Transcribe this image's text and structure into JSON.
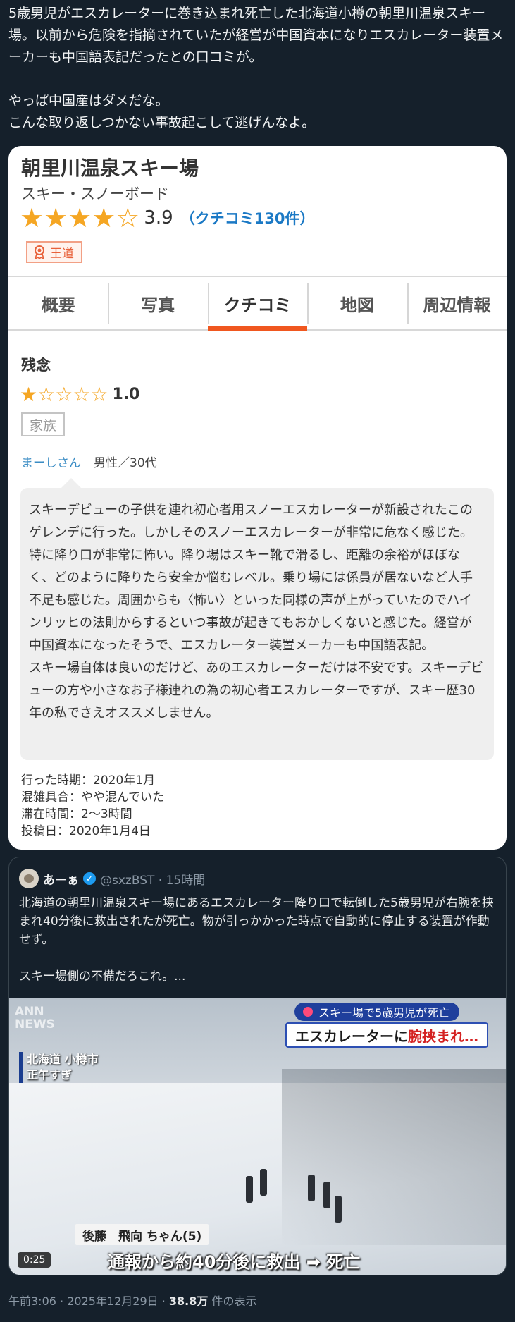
{
  "tweet": {
    "text": "5歳男児がエスカレーターに巻き込まれ死亡した北海道小樽の朝里川温泉スキー場。以前から危険を指摘されていたが経営が中国資本になりエスカレーター装置メーカーも中国語表記だったとの口コミが。\n\nやっぱ中国産はダメだな。\nこんな取り返しつかない事故起こして逃げんなよ。"
  },
  "review_card": {
    "place_title": "朝里川温泉スキー場",
    "category": "スキー・スノーボード",
    "stars_full": "★★★★",
    "stars_empty": "☆",
    "rating": "3.9",
    "review_count": "（クチコミ130件）",
    "badge": "王道",
    "tabs": [
      "概要",
      "写真",
      "クチコミ",
      "地図",
      "周辺情報"
    ],
    "active_tab": "クチコミ",
    "review": {
      "title": "残念",
      "stars_full": "★",
      "stars_empty": "☆☆☆☆",
      "rating": "1.0",
      "tag": "家族",
      "user_name": "まーしさん",
      "user_meta": "男性／30代",
      "body": "スキーデビューの子供を連れ初心者用スノーエスカレーターが新設されたこのゲレンデに行った。しかしそのスノーエスカレーターが非常に危なく感じた。特に降り口が非常に怖い。降り場はスキー靴で滑るし、距離の余裕がほぼなく、どのように降りたら安全か悩むレベル。乗り場には係員が居ないなど人手不足も感じた。周囲からも〈怖い〉といった同様の声が上がっていたのでハインリッヒの法則からするといつ事故が起きてもおかしくないと感じた。経営が中国資本になったそうで、エスカレーター装置メーカーも中国語表記。\nスキー場自体は良いのだけど、あのエスカレーターだけは不安です。スキーデビューの方や小さなお子様連れの為の初心者エスカレーターですが、スキー歴30年の私でさえオススメしません。",
      "visit_period": "行った時期：2020年1月",
      "crowd": "混雑具合：やや混んでいた",
      "stay": "滞在時間：2〜3時間",
      "posted": "投稿日：2020年1月4日"
    }
  },
  "quote": {
    "name": "あーぁ",
    "handle": "@sxzBST · 15時間",
    "text": "北海道の朝里川温泉スキー場にあるエスカレーター降り口で転倒した5歳男児が右腕を挟まれ40分後に救出されたが死亡。物が引っかかった時点で自動的に停止する装置が作動せず。\n\nスキー場側の不備だろこれ。...",
    "video": {
      "logo_line1": "ANN",
      "logo_line2": "NEWS",
      "place_line1": "北海道 小樽市",
      "place_line2": "正午すぎ",
      "chip": "スキー場で5歳男児が死亡",
      "headline_a": "エスカレーターに",
      "headline_b": "腕挟まれ…",
      "nameplate": "後藤　飛向 ちゃん(5)",
      "caption": "通報から約40分後に救出 ➡ 死亡",
      "duration": "0:25"
    }
  },
  "footer": {
    "time": "午前3:06 · 2025年12月29日 · ",
    "views": "38.8万",
    "views_label": " 件の表示"
  },
  "colors": {
    "background": "#15202b",
    "star": "#f5a623",
    "active_tab": "#f0571f",
    "link_blue": "#1b79c5",
    "verified": "#1d9bf0"
  },
  "icons": [
    "badge-ribbon-icon",
    "verified-icon",
    "play-dot-icon"
  ]
}
